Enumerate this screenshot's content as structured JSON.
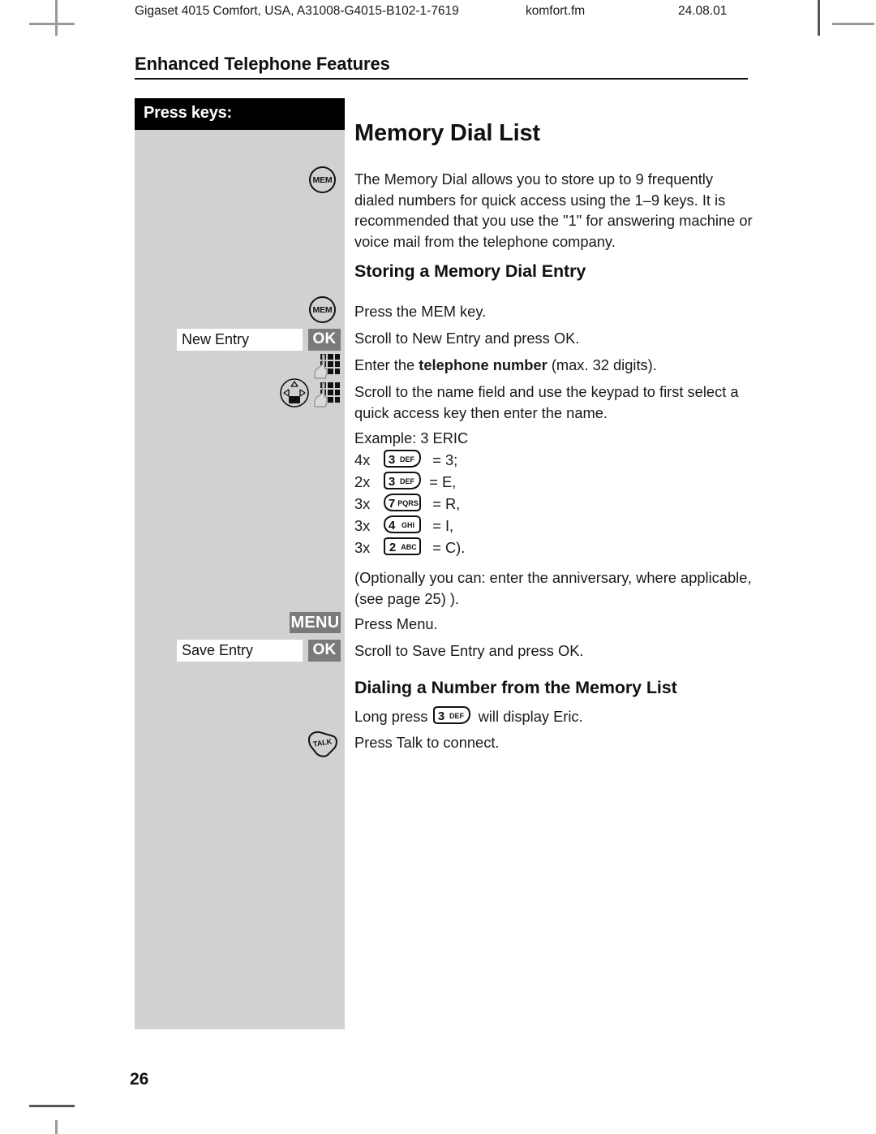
{
  "header": {
    "doc_ref": "Gigaset 4015 Comfort, USA, A31008-G4015-B102-1-7619",
    "file_name": "komfort.fm",
    "doc_date": "24.08.01"
  },
  "chapter_title": "Enhanced Telephone Features",
  "sidebar": {
    "heading": "Press keys:",
    "items": [
      {
        "name": "mem-key",
        "label": "MEM"
      },
      {
        "name": "mem-key",
        "label": "MEM"
      },
      {
        "name": "display-field",
        "label": "New Entry"
      },
      {
        "name": "ok-softkey",
        "label": "OK"
      },
      {
        "name": "keypad-icon",
        "label": "keypad"
      },
      {
        "name": "nav-icon",
        "label": "navigation"
      },
      {
        "name": "menu-softkey",
        "label": "MENU"
      },
      {
        "name": "display-field",
        "label": "Save Entry"
      },
      {
        "name": "ok-softkey",
        "label": "OK"
      },
      {
        "name": "talk-key",
        "label": "TALK"
      }
    ]
  },
  "main": {
    "title": "Memory Dial List",
    "intro": "The Memory Dial allows you to store up to 9 frequently dialed numbers for quick access using the 1–9 keys. It is recommended that you use the \"1\" for answering machine or voice mail from the telephone company.",
    "section1_heading": "Storing a Memory Dial Entry",
    "step1": "Press the MEM key.",
    "step2": "Scroll to New Entry and press OK.",
    "step3_pre": "Enter the ",
    "step3_bold": "telephone number",
    "step3_post": " (max. 32 digits).",
    "step4": "Scroll to the name field and use the keypad  to first select a quick access key then enter the name.",
    "example_label": "Example: 3 ERIC",
    "example_rows": [
      {
        "count": "4x",
        "digit": "3",
        "letters": "DEF",
        "result": "= 3;"
      },
      {
        "count": "2x",
        "digit": "3",
        "letters": "DEF",
        "result": "= E,"
      },
      {
        "count": "3x",
        "digit": "7",
        "letters": "PQRS",
        "result": "= R,"
      },
      {
        "count": "3x",
        "digit": "4",
        "letters": "GHI",
        "result": "= I,"
      },
      {
        "count": "3x",
        "digit": "2",
        "letters": "ABC",
        "result": "= C)."
      }
    ],
    "optional_note": "(Optionally you can: enter the anniversary, where applicable, (see page 25) ).",
    "step5": "Press Menu.",
    "step6": "Scroll to Save Entry and press OK.",
    "section2_heading": "Dialing a Number from the Memory List",
    "dial_pre": "Long press ",
    "dial_key_digit": "3",
    "dial_key_letters": "DEF",
    "dial_post": " will display Eric.",
    "dial_step2": "Press Talk to connect."
  },
  "footer": {
    "page_number": "26"
  },
  "colors": {
    "sidebar_bg": "#d0d2d2",
    "bar_bg": "#000000",
    "softkey_bg": "#7a7a7a",
    "text": "#1a1a1a"
  }
}
